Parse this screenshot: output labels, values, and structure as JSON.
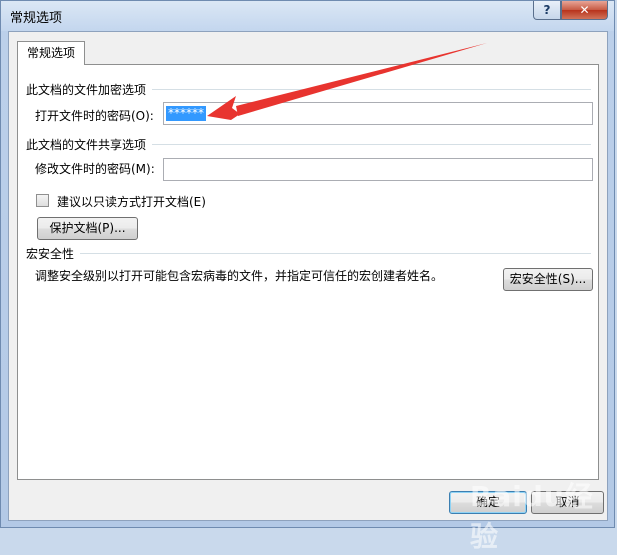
{
  "window": {
    "title": "常规选项"
  },
  "tab": {
    "label": "常规选项"
  },
  "encryption": {
    "heading": "此文档的文件加密选项",
    "open_password_label": "打开文件时的密码(O):",
    "open_password_value": "******"
  },
  "sharing": {
    "heading": "此文档的文件共享选项",
    "modify_password_label": "修改文件时的密码(M):",
    "modify_password_value": "",
    "readonly_label": "建议以只读方式打开文档(E)",
    "readonly_checked": false,
    "protect_button": "保护文档(P)..."
  },
  "macro": {
    "heading": "宏安全性",
    "description": "调整安全级别以打开可能包含宏病毒的文件，并指定可信任的宏创建者姓名。",
    "button": "宏安全性(S)..."
  },
  "footer": {
    "ok_label": "确定",
    "cancel_label": "取消"
  },
  "watermark": {
    "text": "Baidu经验"
  },
  "colors": {
    "annotation_arrow": "#e8342f",
    "selection": "#3399ff"
  }
}
